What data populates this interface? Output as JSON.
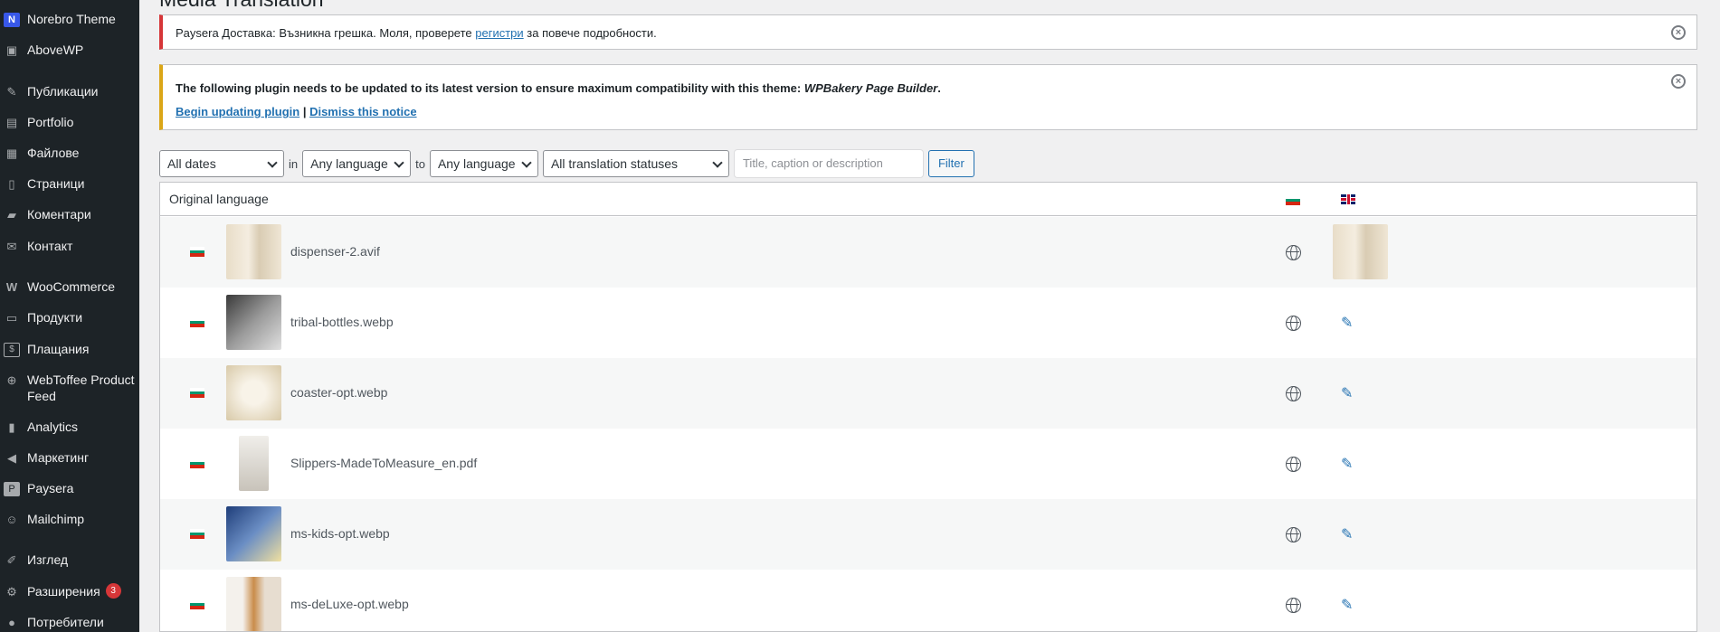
{
  "sidebar": {
    "items": [
      {
        "icon": "norebro-logo-icon",
        "label": "Norebro Theme"
      },
      {
        "icon": "abovewp-icon",
        "label": "AboveWP"
      },
      {
        "icon": "pin-icon",
        "label": "Публикации"
      },
      {
        "icon": "portfolio-icon",
        "label": "Portfolio"
      },
      {
        "icon": "media-icon",
        "label": "Файлове"
      },
      {
        "icon": "pages-icon",
        "label": "Страници"
      },
      {
        "icon": "comments-icon",
        "label": "Коментари"
      },
      {
        "icon": "mail-icon",
        "label": "Контакт"
      },
      {
        "icon": "woocommerce-icon",
        "label": "WooCommerce"
      },
      {
        "icon": "products-icon",
        "label": "Продукти"
      },
      {
        "icon": "payments-icon",
        "label": "Плащания"
      },
      {
        "icon": "cart-icon",
        "label": "WebToffee Product Feed"
      },
      {
        "icon": "analytics-icon",
        "label": "Analytics"
      },
      {
        "icon": "megaphone-icon",
        "label": "Маркетинг"
      },
      {
        "icon": "paysera-icon",
        "label": "Paysera"
      },
      {
        "icon": "mailchimp-icon",
        "label": "Mailchimp"
      },
      {
        "icon": "brush-icon",
        "label": "Изглед"
      },
      {
        "icon": "plugins-icon",
        "label": "Разширения",
        "badge": "3"
      },
      {
        "icon": "users-icon",
        "label": "Потребители"
      }
    ]
  },
  "page": {
    "title": "Media Translation"
  },
  "notices": {
    "error": {
      "text_before": "Paysera Доставка: Възникна грешка. Моля, проверете ",
      "link": "регистри",
      "text_after": " за повече подробности."
    },
    "warning": {
      "text": "The following plugin needs to be updated to its latest version to ensure maximum compatibility with this theme: ",
      "plugin": "WPBakery Page Builder",
      "period": ".",
      "begin_link": "Begin updating plugin",
      "separator": " | ",
      "dismiss_link": "Dismiss this notice"
    }
  },
  "filters": {
    "dates": "All dates",
    "in": "in",
    "from_lang": "Any language",
    "to": "to",
    "to_lang": "Any language",
    "status": "All translation statuses",
    "search_placeholder": "Title, caption or description",
    "button": "Filter"
  },
  "table": {
    "header": "Original language",
    "rows": [
      {
        "file": "dispenser-2.avif",
        "has_translation": true
      },
      {
        "file": "tribal-bottles.webp",
        "has_translation": false
      },
      {
        "file": "coaster-opt.webp",
        "has_translation": false
      },
      {
        "file": "Slippers-MadeToMeasure_en.pdf",
        "has_translation": false
      },
      {
        "file": "ms-kids-opt.webp",
        "has_translation": false
      },
      {
        "file": "ms-deLuxe-opt.webp",
        "has_translation": false
      }
    ]
  }
}
